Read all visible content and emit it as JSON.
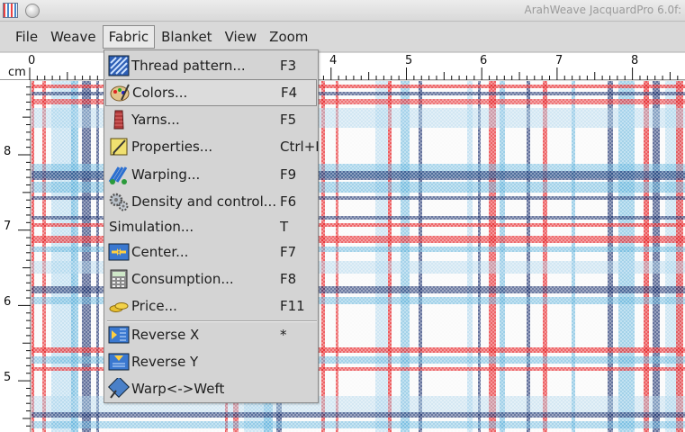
{
  "window": {
    "title": "ArahWeave JacquardPro 6.0f:",
    "icon": "arahweave-app-icon"
  },
  "menubar": {
    "items": [
      {
        "label": "File"
      },
      {
        "label": "Weave"
      },
      {
        "label": "Fabric",
        "active": true
      },
      {
        "label": "Blanket"
      },
      {
        "label": "View"
      },
      {
        "label": "Zoom"
      }
    ]
  },
  "ruler": {
    "unit": "cm",
    "top_labels": [
      "0",
      "4",
      "5",
      "6",
      "7",
      "8"
    ],
    "left_labels": [
      "8",
      "7",
      "6",
      "5"
    ]
  },
  "fabric_menu": {
    "items": [
      {
        "label": "Thread pattern...",
        "shortcut": "F3",
        "icon": "thread-pattern-icon"
      },
      {
        "label": "Colors...",
        "shortcut": "F4",
        "icon": "palette-icon",
        "highlighted": true
      },
      {
        "label": "Yarns...",
        "shortcut": "F5",
        "icon": "yarn-spool-icon"
      },
      {
        "label": "Properties...",
        "shortcut": "Ctrl+I",
        "icon": "properties-icon"
      },
      {
        "label": "Warping...",
        "shortcut": "F9",
        "icon": "warping-icon"
      },
      {
        "label": "Density and control...",
        "shortcut": "F6",
        "icon": "gears-icon"
      },
      {
        "label": "Simulation...",
        "shortcut": "T",
        "icon": ""
      },
      {
        "label": "Center...",
        "shortcut": "F7",
        "icon": "center-icon"
      },
      {
        "label": "Consumption...",
        "shortcut": "F8",
        "icon": "calculator-icon"
      },
      {
        "label": "Price...",
        "shortcut": "F11",
        "icon": "coins-icon"
      },
      {
        "label": "Reverse X",
        "shortcut": "*",
        "icon": "reverse-x-icon"
      },
      {
        "label": "Reverse Y",
        "shortcut": "",
        "icon": "reverse-y-icon"
      },
      {
        "label": "Warp<->Weft",
        "shortcut": "",
        "icon": "warp-weft-swap-icon"
      }
    ]
  },
  "colors": {
    "red": "#e8262a",
    "navy": "#1a2f6e",
    "lightblue": "#5fb2dc",
    "paleblue": "#a9d4ec",
    "white": "#f7f7f7"
  }
}
